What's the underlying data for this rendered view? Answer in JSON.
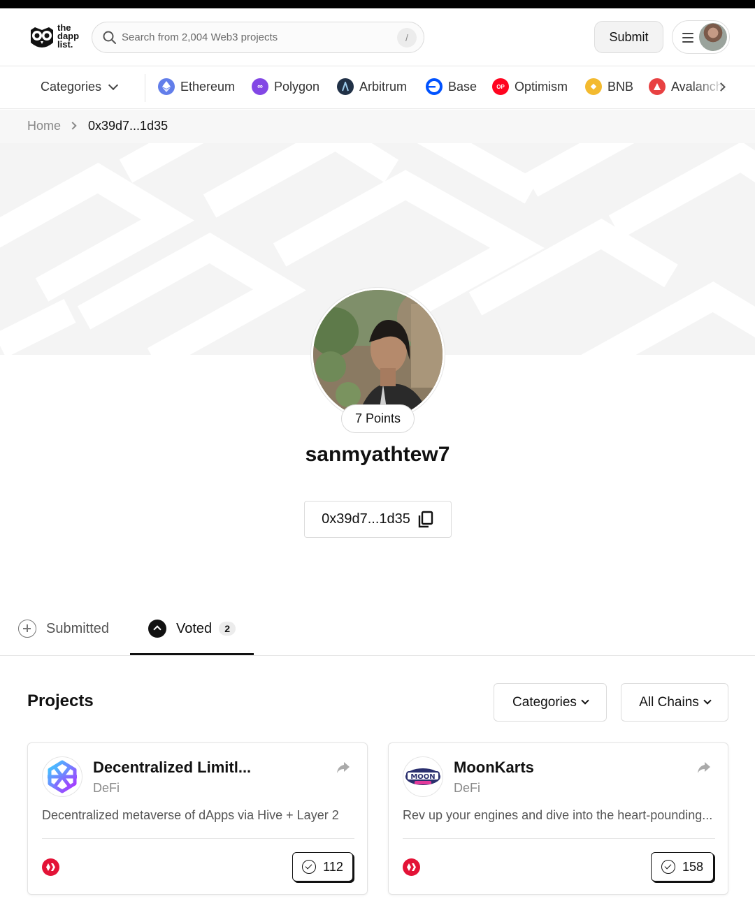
{
  "header": {
    "logo_text": [
      "the",
      "dapp",
      "list."
    ],
    "search_placeholder": "Search from 2,004 Web3 projects",
    "search_shortcut": "/",
    "submit_label": "Submit"
  },
  "chainbar": {
    "categories_label": "Categories",
    "chains": [
      {
        "name": "Ethereum",
        "icon": "ethereum-icon",
        "color": "#627eea"
      },
      {
        "name": "Polygon",
        "icon": "polygon-icon",
        "color": "#8247e5"
      },
      {
        "name": "Arbitrum",
        "icon": "arbitrum-icon",
        "color": "#213147"
      },
      {
        "name": "Base",
        "icon": "base-icon",
        "color": "#0052ff"
      },
      {
        "name": "Optimism",
        "icon": "optimism-icon",
        "color": "#ff0420"
      },
      {
        "name": "BNB",
        "icon": "bnb-icon",
        "color": "#f3ba2f"
      },
      {
        "name": "Avalanche",
        "icon": "avalanche-icon",
        "color": "#e84142"
      }
    ]
  },
  "breadcrumb": {
    "home": "Home",
    "current": "0x39d7...1d35"
  },
  "profile": {
    "points": "7 Points",
    "username": "sanmyathtew7",
    "address": "0x39d7...1d35"
  },
  "tabs": {
    "submitted": "Submitted",
    "voted": "Voted",
    "voted_count": "2",
    "active": "voted"
  },
  "projects": {
    "title": "Projects",
    "filter_categories": "Categories",
    "filter_chains": "All Chains",
    "items": [
      {
        "name": "Decentralized Limitl...",
        "category": "DeFi",
        "description": "Decentralized metaverse of dApps via Hive + Layer 2",
        "chain_icon": "hive-icon",
        "votes": "112"
      },
      {
        "name": "MoonKarts",
        "category": "DeFi",
        "description": "Rev up your engines and dive into the heart-pounding...",
        "chain_icon": "hive-icon",
        "votes": "158"
      }
    ]
  },
  "colors": {
    "accent": "#111111",
    "hive_red": "#e31337",
    "banner_bg": "#f4f4f4"
  }
}
